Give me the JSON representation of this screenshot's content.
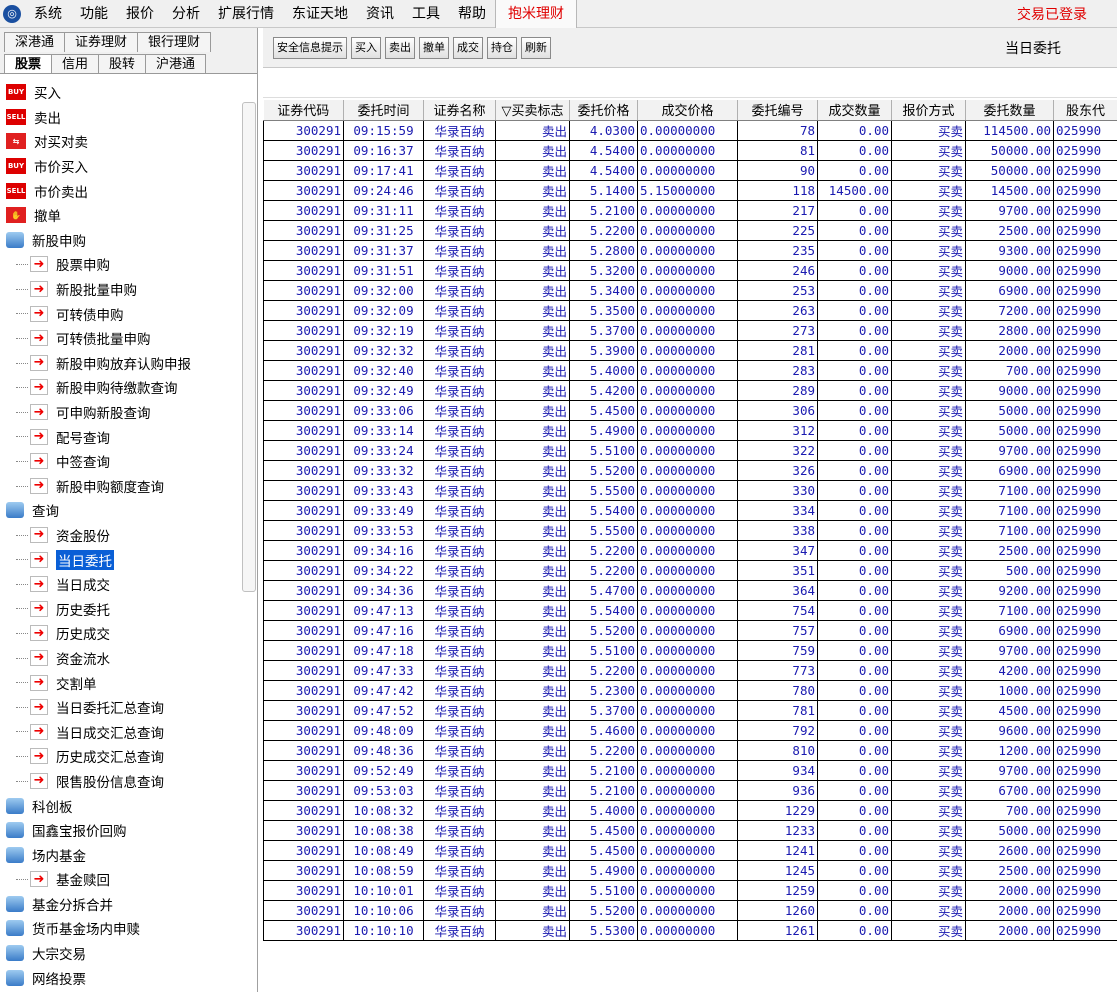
{
  "menu": {
    "items": [
      "系统",
      "功能",
      "报价",
      "分析",
      "扩展行情",
      "东证天地",
      "资讯",
      "工具",
      "帮助"
    ],
    "highlight": "抱米理财",
    "status": "交易已登录"
  },
  "sidebar": {
    "tabs_row1": [
      "深港通",
      "证券理财",
      "银行理财"
    ],
    "tabs_row2": [
      "股票",
      "信用",
      "股转",
      "沪港通"
    ],
    "tree": [
      {
        "label": "买入",
        "level": 0,
        "icon": "buy-icon"
      },
      {
        "label": "卖出",
        "level": 0,
        "icon": "sell-icon"
      },
      {
        "label": "对买对卖",
        "level": 0,
        "icon": "buy-sell-pair-icon"
      },
      {
        "label": "市价买入",
        "level": 0,
        "icon": "buy-icon"
      },
      {
        "label": "市价卖出",
        "level": 0,
        "icon": "sell-icon"
      },
      {
        "label": "撤单",
        "level": 0,
        "icon": "cancel-hand-icon"
      },
      {
        "label": "新股申购",
        "level": 0,
        "icon": "folder-search-icon"
      },
      {
        "label": "股票申购",
        "level": 1,
        "icon": "arrow-right-icon"
      },
      {
        "label": "新股批量申购",
        "level": 1,
        "icon": "arrow-right-icon"
      },
      {
        "label": "可转债申购",
        "level": 1,
        "icon": "arrow-right-icon"
      },
      {
        "label": "可转债批量申购",
        "level": 1,
        "icon": "arrow-right-icon"
      },
      {
        "label": "新股申购放弃认购申报",
        "level": 1,
        "icon": "arrow-right-icon"
      },
      {
        "label": "新股申购待缴款查询",
        "level": 1,
        "icon": "arrow-right-icon"
      },
      {
        "label": "可申购新股查询",
        "level": 1,
        "icon": "arrow-right-icon"
      },
      {
        "label": "配号查询",
        "level": 1,
        "icon": "arrow-right-icon"
      },
      {
        "label": "中签查询",
        "level": 1,
        "icon": "arrow-right-icon"
      },
      {
        "label": "新股申购额度查询",
        "level": 1,
        "icon": "arrow-right-icon"
      },
      {
        "label": "查询",
        "level": 0,
        "icon": "folder-search-icon"
      },
      {
        "label": "资金股份",
        "level": 1,
        "icon": "arrow-right-icon"
      },
      {
        "label": "当日委托",
        "level": 1,
        "icon": "arrow-right-icon",
        "selected": true
      },
      {
        "label": "当日成交",
        "level": 1,
        "icon": "arrow-right-icon"
      },
      {
        "label": "历史委托",
        "level": 1,
        "icon": "arrow-right-icon"
      },
      {
        "label": "历史成交",
        "level": 1,
        "icon": "arrow-right-icon"
      },
      {
        "label": "资金流水",
        "level": 1,
        "icon": "arrow-right-icon"
      },
      {
        "label": "交割单",
        "level": 1,
        "icon": "arrow-right-icon"
      },
      {
        "label": "当日委托汇总查询",
        "level": 1,
        "icon": "arrow-right-icon"
      },
      {
        "label": "当日成交汇总查询",
        "level": 1,
        "icon": "arrow-right-icon"
      },
      {
        "label": "历史成交汇总查询",
        "level": 1,
        "icon": "arrow-right-icon"
      },
      {
        "label": "限售股份信息查询",
        "level": 1,
        "icon": "arrow-right-icon"
      },
      {
        "label": "科创板",
        "level": 0,
        "icon": "folder-search-icon"
      },
      {
        "label": "国鑫宝报价回购",
        "level": 0,
        "icon": "folder-search-icon"
      },
      {
        "label": "场内基金",
        "level": 0,
        "icon": "folder-search-icon"
      },
      {
        "label": "基金赎回",
        "level": 1,
        "icon": "arrow-right-icon"
      },
      {
        "label": "基金分拆合并",
        "level": 0,
        "icon": "folder-search-icon"
      },
      {
        "label": "货币基金场内申赎",
        "level": 0,
        "icon": "folder-search-icon"
      },
      {
        "label": "大宗交易",
        "level": 0,
        "icon": "folder-search-icon"
      },
      {
        "label": "网络投票",
        "level": 0,
        "icon": "folder-search-icon"
      }
    ]
  },
  "toolbar": {
    "buttons": [
      "安全信息提示",
      "买入",
      "卖出",
      "撤单",
      "成交",
      "持仓",
      "刷新"
    ],
    "title": "当日委托"
  },
  "table": {
    "headers": [
      "证券代码",
      "委托时间",
      "证券名称",
      "▽买卖标志",
      "委托价格",
      "成交价格",
      "委托编号",
      "成交数量",
      "报价方式",
      "委托数量",
      "股东代"
    ],
    "rows": [
      [
        "300291",
        "09:15:59",
        "华录百纳",
        "卖出",
        "4.0300",
        "0.00000000",
        "78",
        "0.00",
        "买卖",
        "114500.00",
        "025990"
      ],
      [
        "300291",
        "09:16:37",
        "华录百纳",
        "卖出",
        "4.5400",
        "0.00000000",
        "81",
        "0.00",
        "买卖",
        "50000.00",
        "025990"
      ],
      [
        "300291",
        "09:17:41",
        "华录百纳",
        "卖出",
        "4.5400",
        "0.00000000",
        "90",
        "0.00",
        "买卖",
        "50000.00",
        "025990"
      ],
      [
        "300291",
        "09:24:46",
        "华录百纳",
        "卖出",
        "5.1400",
        "5.15000000",
        "118",
        "14500.00",
        "买卖",
        "14500.00",
        "025990"
      ],
      [
        "300291",
        "09:31:11",
        "华录百纳",
        "卖出",
        "5.2100",
        "0.00000000",
        "217",
        "0.00",
        "买卖",
        "9700.00",
        "025990"
      ],
      [
        "300291",
        "09:31:25",
        "华录百纳",
        "卖出",
        "5.2200",
        "0.00000000",
        "225",
        "0.00",
        "买卖",
        "2500.00",
        "025990"
      ],
      [
        "300291",
        "09:31:37",
        "华录百纳",
        "卖出",
        "5.2800",
        "0.00000000",
        "235",
        "0.00",
        "买卖",
        "9300.00",
        "025990"
      ],
      [
        "300291",
        "09:31:51",
        "华录百纳",
        "卖出",
        "5.3200",
        "0.00000000",
        "246",
        "0.00",
        "买卖",
        "9000.00",
        "025990"
      ],
      [
        "300291",
        "09:32:00",
        "华录百纳",
        "卖出",
        "5.3400",
        "0.00000000",
        "253",
        "0.00",
        "买卖",
        "6900.00",
        "025990"
      ],
      [
        "300291",
        "09:32:09",
        "华录百纳",
        "卖出",
        "5.3500",
        "0.00000000",
        "263",
        "0.00",
        "买卖",
        "7200.00",
        "025990"
      ],
      [
        "300291",
        "09:32:19",
        "华录百纳",
        "卖出",
        "5.3700",
        "0.00000000",
        "273",
        "0.00",
        "买卖",
        "2800.00",
        "025990"
      ],
      [
        "300291",
        "09:32:32",
        "华录百纳",
        "卖出",
        "5.3900",
        "0.00000000",
        "281",
        "0.00",
        "买卖",
        "2000.00",
        "025990"
      ],
      [
        "300291",
        "09:32:40",
        "华录百纳",
        "卖出",
        "5.4000",
        "0.00000000",
        "283",
        "0.00",
        "买卖",
        "700.00",
        "025990"
      ],
      [
        "300291",
        "09:32:49",
        "华录百纳",
        "卖出",
        "5.4200",
        "0.00000000",
        "289",
        "0.00",
        "买卖",
        "9000.00",
        "025990"
      ],
      [
        "300291",
        "09:33:06",
        "华录百纳",
        "卖出",
        "5.4500",
        "0.00000000",
        "306",
        "0.00",
        "买卖",
        "5000.00",
        "025990"
      ],
      [
        "300291",
        "09:33:14",
        "华录百纳",
        "卖出",
        "5.4900",
        "0.00000000",
        "312",
        "0.00",
        "买卖",
        "5000.00",
        "025990"
      ],
      [
        "300291",
        "09:33:24",
        "华录百纳",
        "卖出",
        "5.5100",
        "0.00000000",
        "322",
        "0.00",
        "买卖",
        "9700.00",
        "025990"
      ],
      [
        "300291",
        "09:33:32",
        "华录百纳",
        "卖出",
        "5.5200",
        "0.00000000",
        "326",
        "0.00",
        "买卖",
        "6900.00",
        "025990"
      ],
      [
        "300291",
        "09:33:43",
        "华录百纳",
        "卖出",
        "5.5500",
        "0.00000000",
        "330",
        "0.00",
        "买卖",
        "7100.00",
        "025990"
      ],
      [
        "300291",
        "09:33:49",
        "华录百纳",
        "卖出",
        "5.5400",
        "0.00000000",
        "334",
        "0.00",
        "买卖",
        "7100.00",
        "025990"
      ],
      [
        "300291",
        "09:33:53",
        "华录百纳",
        "卖出",
        "5.5500",
        "0.00000000",
        "338",
        "0.00",
        "买卖",
        "7100.00",
        "025990"
      ],
      [
        "300291",
        "09:34:16",
        "华录百纳",
        "卖出",
        "5.2200",
        "0.00000000",
        "347",
        "0.00",
        "买卖",
        "2500.00",
        "025990"
      ],
      [
        "300291",
        "09:34:22",
        "华录百纳",
        "卖出",
        "5.2200",
        "0.00000000",
        "351",
        "0.00",
        "买卖",
        "500.00",
        "025990"
      ],
      [
        "300291",
        "09:34:36",
        "华录百纳",
        "卖出",
        "5.4700",
        "0.00000000",
        "364",
        "0.00",
        "买卖",
        "9200.00",
        "025990"
      ],
      [
        "300291",
        "09:47:13",
        "华录百纳",
        "卖出",
        "5.5400",
        "0.00000000",
        "754",
        "0.00",
        "买卖",
        "7100.00",
        "025990"
      ],
      [
        "300291",
        "09:47:16",
        "华录百纳",
        "卖出",
        "5.5200",
        "0.00000000",
        "757",
        "0.00",
        "买卖",
        "6900.00",
        "025990"
      ],
      [
        "300291",
        "09:47:18",
        "华录百纳",
        "卖出",
        "5.5100",
        "0.00000000",
        "759",
        "0.00",
        "买卖",
        "9700.00",
        "025990"
      ],
      [
        "300291",
        "09:47:33",
        "华录百纳",
        "卖出",
        "5.2200",
        "0.00000000",
        "773",
        "0.00",
        "买卖",
        "4200.00",
        "025990"
      ],
      [
        "300291",
        "09:47:42",
        "华录百纳",
        "卖出",
        "5.2300",
        "0.00000000",
        "780",
        "0.00",
        "买卖",
        "1000.00",
        "025990"
      ],
      [
        "300291",
        "09:47:52",
        "华录百纳",
        "卖出",
        "5.3700",
        "0.00000000",
        "781",
        "0.00",
        "买卖",
        "4500.00",
        "025990"
      ],
      [
        "300291",
        "09:48:09",
        "华录百纳",
        "卖出",
        "5.4600",
        "0.00000000",
        "792",
        "0.00",
        "买卖",
        "9600.00",
        "025990"
      ],
      [
        "300291",
        "09:48:36",
        "华录百纳",
        "卖出",
        "5.2200",
        "0.00000000",
        "810",
        "0.00",
        "买卖",
        "1200.00",
        "025990"
      ],
      [
        "300291",
        "09:52:49",
        "华录百纳",
        "卖出",
        "5.2100",
        "0.00000000",
        "934",
        "0.00",
        "买卖",
        "9700.00",
        "025990"
      ],
      [
        "300291",
        "09:53:03",
        "华录百纳",
        "卖出",
        "5.2100",
        "0.00000000",
        "936",
        "0.00",
        "买卖",
        "6700.00",
        "025990"
      ],
      [
        "300291",
        "10:08:32",
        "华录百纳",
        "卖出",
        "5.4000",
        "0.00000000",
        "1229",
        "0.00",
        "买卖",
        "700.00",
        "025990"
      ],
      [
        "300291",
        "10:08:38",
        "华录百纳",
        "卖出",
        "5.4500",
        "0.00000000",
        "1233",
        "0.00",
        "买卖",
        "5000.00",
        "025990"
      ],
      [
        "300291",
        "10:08:49",
        "华录百纳",
        "卖出",
        "5.4500",
        "0.00000000",
        "1241",
        "0.00",
        "买卖",
        "2600.00",
        "025990"
      ],
      [
        "300291",
        "10:08:59",
        "华录百纳",
        "卖出",
        "5.4900",
        "0.00000000",
        "1245",
        "0.00",
        "买卖",
        "2500.00",
        "025990"
      ],
      [
        "300291",
        "10:10:01",
        "华录百纳",
        "卖出",
        "5.5100",
        "0.00000000",
        "1259",
        "0.00",
        "买卖",
        "2000.00",
        "025990"
      ],
      [
        "300291",
        "10:10:06",
        "华录百纳",
        "卖出",
        "5.5200",
        "0.00000000",
        "1260",
        "0.00",
        "买卖",
        "2000.00",
        "025990"
      ],
      [
        "300291",
        "10:10:10",
        "华录百纳",
        "卖出",
        "5.5300",
        "0.00000000",
        "1261",
        "0.00",
        "买卖",
        "2000.00",
        "025990"
      ]
    ]
  }
}
